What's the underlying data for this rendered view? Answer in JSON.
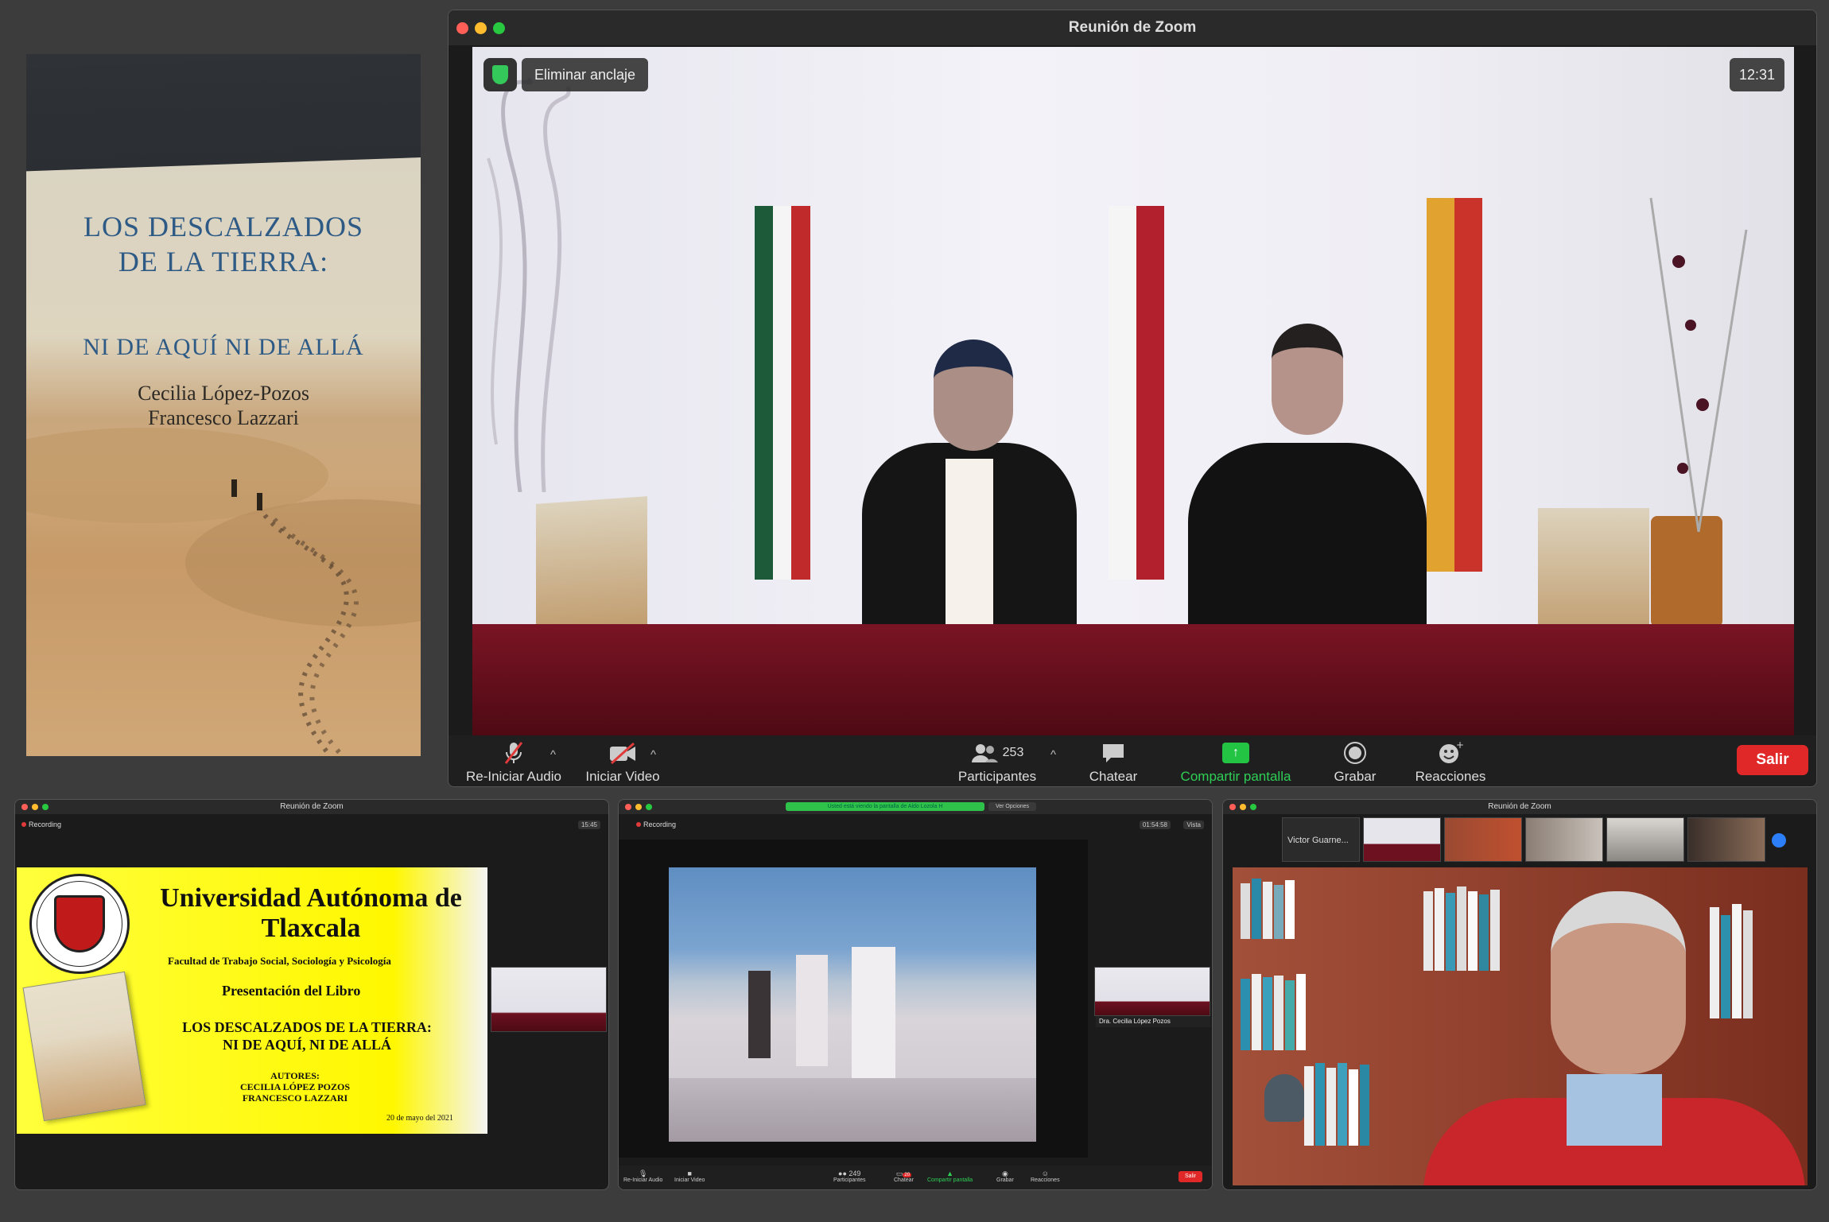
{
  "book_cover": {
    "title_line1": "LOS DESCALZADOS",
    "title_line2": "DE LA TIERRA:",
    "subtitle": "NI DE AQUÍ NI DE ALLÁ",
    "author1": "Cecilia López-Pozos",
    "author2": "Francesco Lazzari"
  },
  "main_window": {
    "title": "Reunión de Zoom",
    "unpin_label": "Eliminar anclaje",
    "meeting_time": "12:31",
    "toolbar": {
      "audio_label": "Re-Iniciar Audio",
      "video_label": "Iniciar Video",
      "participants_label": "Participantes",
      "participants_count": "253",
      "chat_label": "Chatear",
      "share_label": "Compartir pantalla",
      "record_label": "Grabar",
      "reactions_label": "Reacciones",
      "exit_label": "Salir"
    }
  },
  "window_slide": {
    "title": "Reunión de Zoom",
    "recording": "Recording",
    "time": "15:45",
    "slide": {
      "university": "Universidad Autónoma de Tlaxcala",
      "faculty": "Facultad de Trabajo Social, Sociología y Psicología",
      "presentation": "Presentación del Libro",
      "book_title_1": "LOS DESCALZADOS DE LA TIERRA:",
      "book_title_2": "NI DE AQUÍ, NI DE ALLÁ",
      "authors_label": "AUTORES:",
      "author1": "CECILIA LÓPEZ POZOS",
      "author2": "FRANCESCO LAZZARI",
      "date": "20 de mayo  del 2021",
      "seal_year": "MCMLXXVI",
      "seal_text": "UNIVERSIDAD AUTÓNOMA DE TLAXCALA",
      "mini_book_title": "LOS DESCALZADOS DE LA TIERRA",
      "mini_book_subtitle": "NI DE AQUÍ NI DE ALLÁ"
    }
  },
  "window_video": {
    "share_notice": "Usted está viendo la pantalla de Aldo Lozola H",
    "view_options": "Ver Opciones",
    "recording": "Recording",
    "time": "01:54:58",
    "view": "Vista",
    "participant_name": "Dra. Cecilia López Pozos",
    "toolbar": {
      "audio": "Re-Iniciar Audio",
      "video": "Iniciar Video",
      "participants": "Participantes",
      "participants_count": "249",
      "chat": "Chatear",
      "chat_badge": "20",
      "share": "Compartir pantalla",
      "record": "Grabar",
      "reactions": "Reacciones",
      "exit": "Salir"
    }
  },
  "window_gallery": {
    "title": "Reunión de Zoom",
    "first_participant": "Victor Guarne..."
  },
  "colors": {
    "zoom_green": "#23c343",
    "exit_red": "#e02828",
    "slide_yellow": "#fff700",
    "book_blue": "#2e5a86",
    "table_cloth": "#6b1020"
  }
}
